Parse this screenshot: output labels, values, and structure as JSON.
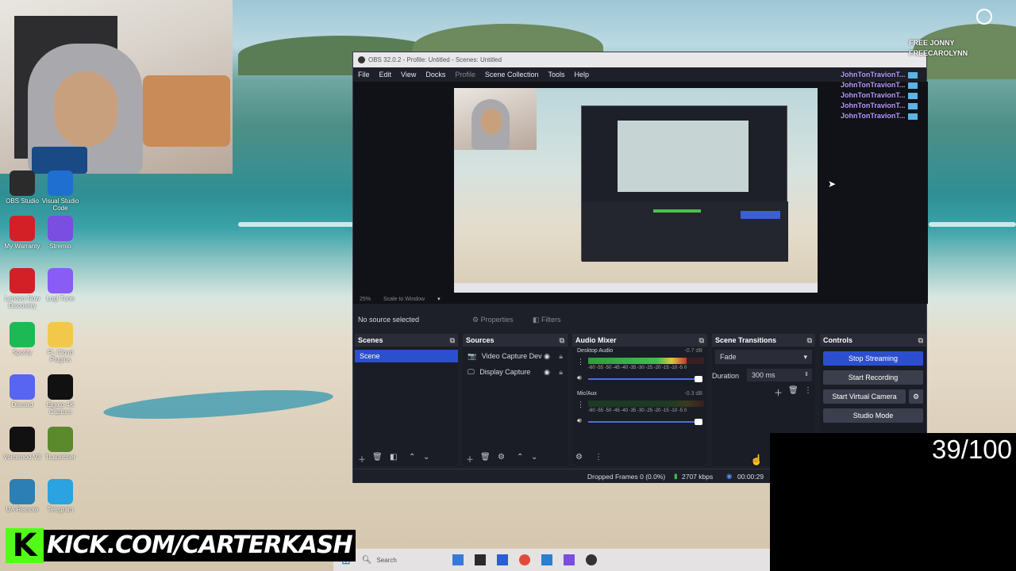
{
  "obs": {
    "title": "OBS 32.0.2 - Profile: Untitled - Scenes: Untitled",
    "menu": [
      "File",
      "Edit",
      "View",
      "Docks",
      "Profile",
      "Scene Collection",
      "Tools",
      "Help"
    ],
    "zoom_label": "25%",
    "scale_label": "Scale to Window",
    "no_source": "No source selected",
    "properties_label": "Properties",
    "filters_label": "Filters",
    "scenes": {
      "header": "Scenes",
      "items": [
        "Scene"
      ]
    },
    "sources": {
      "header": "Sources",
      "items": [
        "Video Capture Dev",
        "Display Capture"
      ]
    },
    "audio_mixer": {
      "header": "Audio Mixer",
      "channels": [
        {
          "name": "Desktop Audio",
          "db": "-0.7 dB",
          "level": 0.85
        },
        {
          "name": "Mic/Aux",
          "db": "-0.3 dB",
          "level": 0.0
        }
      ],
      "scale_ticks": "-60 -55 -50 -45 -40 -35 -30 -25 -20 -15 -10 -5 0"
    },
    "transitions": {
      "header": "Scene Transitions",
      "selected": "Fade",
      "duration_label": "Duration",
      "duration_value": "300 ms"
    },
    "controls": {
      "header": "Controls",
      "stop_streaming": "Stop Streaming",
      "start_recording": "Start Recording",
      "start_virtual_camera": "Start Virtual Camera",
      "studio_mode": "Studio Mode"
    },
    "status": {
      "dropped_frames": "Dropped Frames 0 (0.0%)",
      "bitrate": "2707 kbps",
      "time": "00:00:29"
    }
  },
  "chat": {
    "entries": [
      "JohnTonTravionT...",
      "JohnTonTravionT...",
      "JohnTonTravionT...",
      "JohnTonTravionT...",
      "JohnTonTravionT..."
    ],
    "overlay_lines": [
      "FREE JONNY",
      "FREECAROLYNN"
    ]
  },
  "desktop_icons": [
    {
      "label": "OBS Studio",
      "color": "#2b2b2b"
    },
    {
      "label": "Visual Studio Code",
      "color": "#1f6fd0"
    },
    {
      "label": "My Warranty",
      "color": "#d32027"
    },
    {
      "label": "Stremio",
      "color": "#7a4ee0"
    },
    {
      "label": "Lenovo Now Discovery",
      "color": "#d32027"
    },
    {
      "label": "Logi Tune",
      "color": "#8a5cf6"
    },
    {
      "label": "Spotify",
      "color": "#1db954"
    },
    {
      "label": "FL Cloud Plugins",
      "color": "#f2c84b"
    },
    {
      "label": "Discord",
      "color": "#5865f2"
    },
    {
      "label": "Elgato 4K Capture",
      "color": "#111111"
    },
    {
      "label": "Voicemod V3",
      "color": "#111111"
    },
    {
      "label": "TLauncher",
      "color": "#5a8a2c"
    },
    {
      "label": "UA Remote",
      "color": "#2b7fb4"
    },
    {
      "label": "Telegram",
      "color": "#2aa3e0"
    }
  ],
  "counter": "39/100",
  "kick": {
    "logo": "K",
    "url": "KICK.COM/CARTERKASH"
  },
  "taskbar": {
    "search_placeholder": "Search"
  }
}
